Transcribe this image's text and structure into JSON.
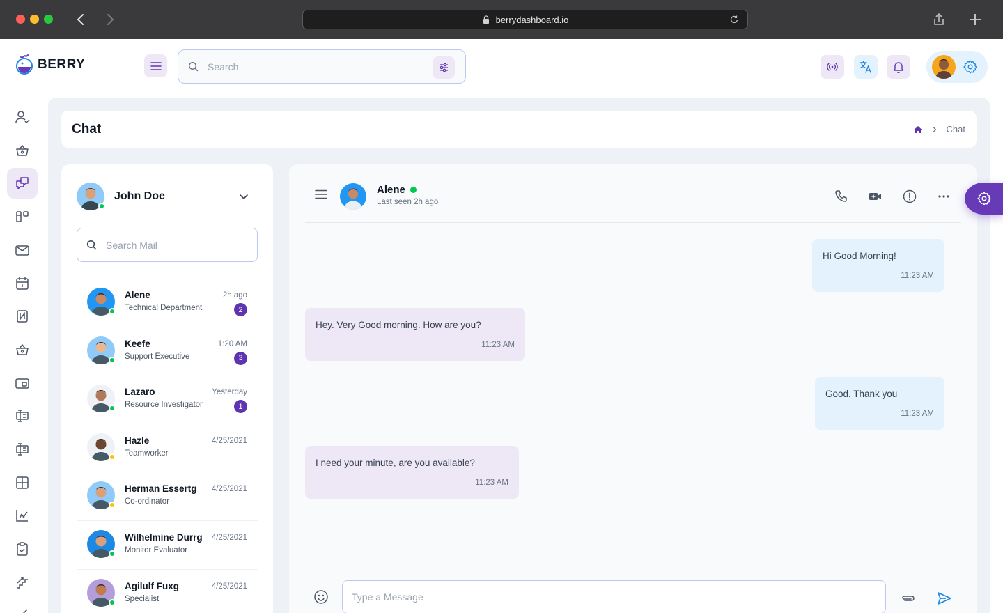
{
  "browser": {
    "url": "berrydashboard.io"
  },
  "brand": {
    "name": "BERRY",
    "accent": "#673ab7",
    "accent_light": "#ede7f6",
    "secondary_light": "#e3f2fd"
  },
  "header": {
    "search_placeholder": "Search",
    "icons": [
      "menu-icon",
      "search-icon",
      "filter-icon",
      "broadcast-icon",
      "translate-icon",
      "bell-icon",
      "gear-icon"
    ]
  },
  "sidebar": {
    "items": [
      {
        "icon": "user-check-icon"
      },
      {
        "icon": "basket-icon"
      },
      {
        "icon": "chat-icon",
        "active": true
      },
      {
        "icon": "kanban-icon"
      },
      {
        "icon": "mail-icon"
      },
      {
        "icon": "calendar-icon"
      },
      {
        "icon": "nfc-icon"
      },
      {
        "icon": "basket-icon"
      },
      {
        "icon": "wallet-icon"
      },
      {
        "icon": "columns-icon"
      },
      {
        "icon": "columns-icon"
      },
      {
        "icon": "table-icon"
      },
      {
        "icon": "chart-icon"
      },
      {
        "icon": "clipboard-check-icon"
      },
      {
        "icon": "stairs-icon"
      },
      {
        "icon": "brush-icon"
      }
    ]
  },
  "page": {
    "title": "Chat",
    "breadcrumb_current": "Chat"
  },
  "me": {
    "name": "John Doe",
    "search_placeholder": "Search Mail"
  },
  "contacts": [
    {
      "name": "Alene",
      "role": "Technical Department",
      "time": "2h ago",
      "unread": "2",
      "status": "online",
      "skin": "#c68a67",
      "bg": "#2196f3"
    },
    {
      "name": "Keefe",
      "role": "Support Executive",
      "time": "1:20 AM",
      "unread": "3",
      "status": "online",
      "skin": "#e8b896",
      "bg": "#90caf9"
    },
    {
      "name": "Lazaro",
      "role": "Resource Investigator",
      "time": "Yesterday",
      "unread": "1",
      "status": "online",
      "skin": "#b07a5a",
      "bg": "#eef2f6"
    },
    {
      "name": "Hazle",
      "role": "Teamworker",
      "time": "4/25/2021",
      "unread": "",
      "status": "away",
      "skin": "#6b4632",
      "bg": "#eef2f6"
    },
    {
      "name": "Herman Essertg",
      "role": "Co-ordinator",
      "time": "4/25/2021",
      "unread": "",
      "status": "away",
      "skin": "#d9a17a",
      "bg": "#90caf9"
    },
    {
      "name": "Wilhelmine Durrg",
      "role": "Monitor Evaluator",
      "time": "4/25/2021",
      "unread": "",
      "status": "online",
      "skin": "#d8a07b",
      "bg": "#1e88e5"
    },
    {
      "name": "Agilulf Fuxg",
      "role": "Specialist",
      "time": "4/25/2021",
      "unread": "",
      "status": "online",
      "skin": "#c07c4f",
      "bg": "#b39ddb"
    }
  ],
  "conversation": {
    "name": "Alene",
    "last_seen": "Last seen 2h ago",
    "messages": [
      {
        "dir": "out",
        "text": "Hi Good Morning!",
        "time": "11:23 AM"
      },
      {
        "dir": "in",
        "text": "Hey. Very Good morning. How are you?",
        "time": "11:23 AM"
      },
      {
        "dir": "out",
        "text": "Good. Thank you",
        "time": "11:23 AM"
      },
      {
        "dir": "in",
        "text": "I need your minute, are you available?",
        "time": "11:23 AM"
      }
    ],
    "composer_placeholder": "Type a Message"
  }
}
